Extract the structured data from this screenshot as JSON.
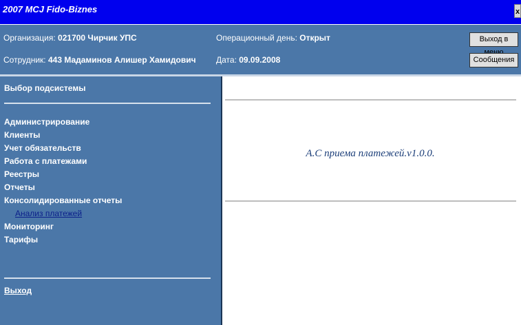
{
  "window": {
    "title": "2007 MCJ Fido-Biznes",
    "close_label": "x"
  },
  "info": {
    "org_label": "Организация: ",
    "org_value": "021700 Чирчик УПС",
    "day_label": "Операционный день: ",
    "day_value": "Открыт",
    "emp_label": "Сотрудник: ",
    "emp_value": "443 Мадаминов Алишер Хамидович",
    "date_label": "Дата: ",
    "date_value": "09.09.2008",
    "btn_exit_menu": "Выход в меню",
    "btn_messages": "Сообщения"
  },
  "sidebar": {
    "header": "Выбор подсистемы",
    "items": [
      "Администрирование",
      "Клиенты",
      "Учет обязательств",
      "Работа с платежами",
      "Реестры",
      "Отчеты",
      "Консолидированные отчеты"
    ],
    "sub_item": "Анализ платежей",
    "items_after": [
      "Мониторинг",
      "Тарифы"
    ],
    "exit": "Выход"
  },
  "content": {
    "text": "А.С приема платежей.v1.0.0."
  },
  "colors": {
    "title_bar": "#0000ee",
    "panel": "#4b77a8",
    "link": "#0b1f8a"
  }
}
